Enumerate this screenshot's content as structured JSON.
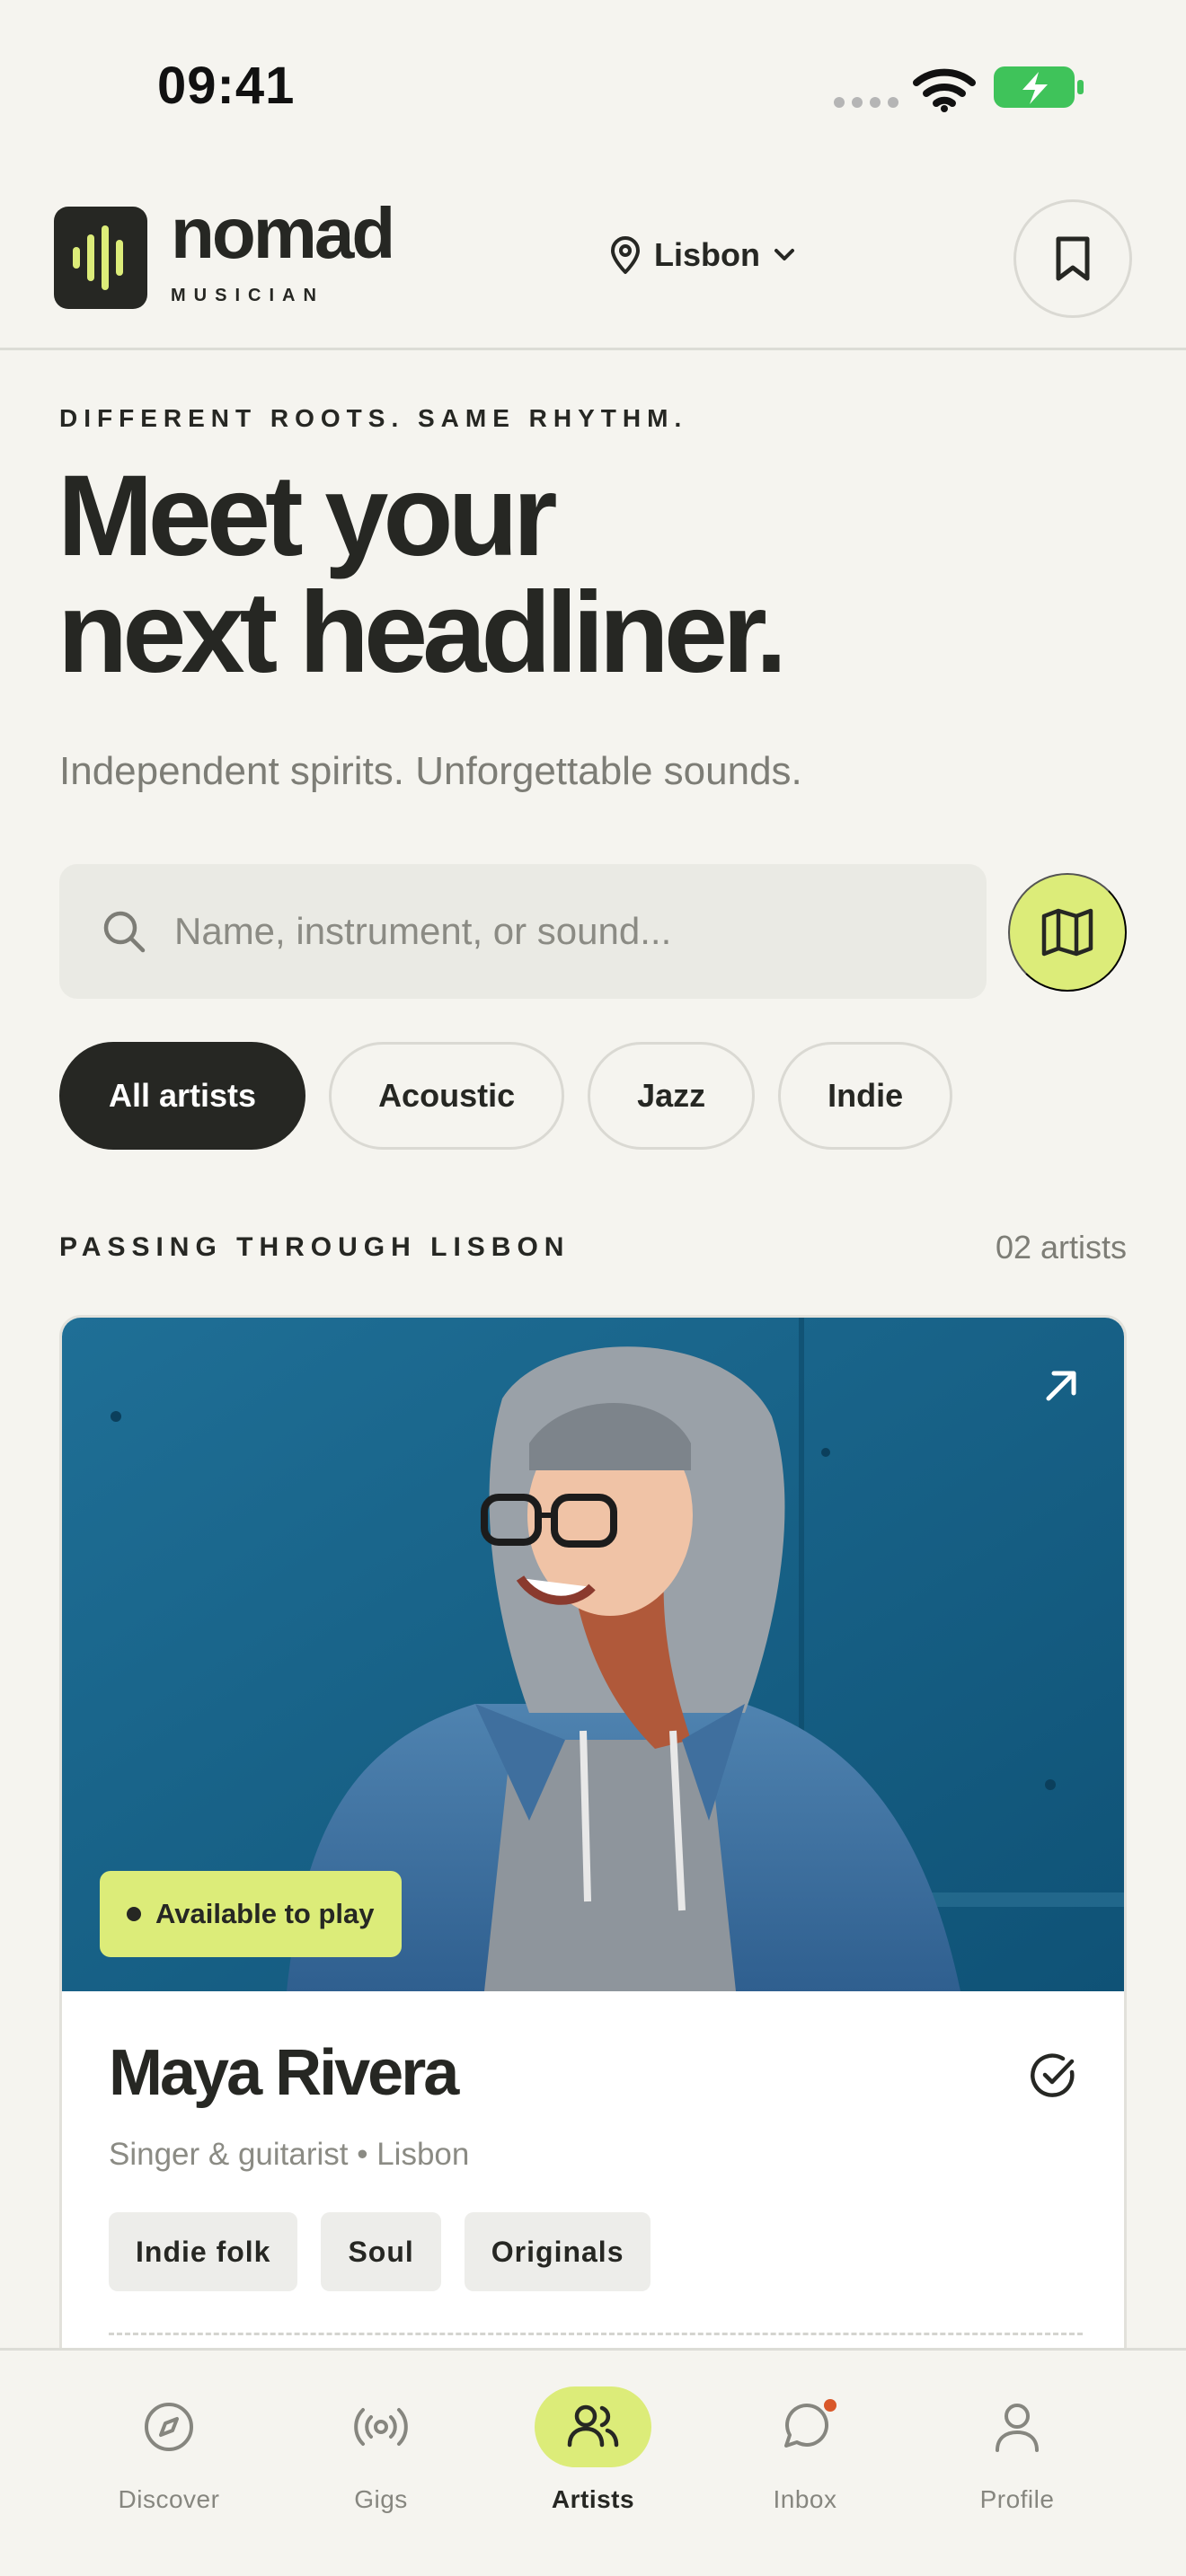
{
  "status_bar": {
    "time": "09:41"
  },
  "header": {
    "logo_word": "nomad",
    "logo_sub": "MUSICIAN",
    "location": "Lisbon"
  },
  "hero": {
    "eyebrow": "DIFFERENT ROOTS. SAME RHYTHM.",
    "title_line1": "Meet your",
    "title_line2": "next headliner.",
    "subtitle": "Independent spirits. Unforgettable sounds."
  },
  "search": {
    "placeholder": "Name, instrument, or sound..."
  },
  "filters": [
    {
      "label": "All artists",
      "active": true
    },
    {
      "label": "Acoustic",
      "active": false
    },
    {
      "label": "Jazz",
      "active": false
    },
    {
      "label": "Indie",
      "active": false
    }
  ],
  "section": {
    "title": "PASSING THROUGH LISBON",
    "count": "02 artists"
  },
  "artist": {
    "availability": "Available to play",
    "name": "Maya Rivera",
    "meta": "Singer & guitarist • Lisbon",
    "tags": [
      "Indie folk",
      "Soul",
      "Originals"
    ]
  },
  "bottom_nav": [
    {
      "label": "Discover",
      "icon": "compass-icon"
    },
    {
      "label": "Gigs",
      "icon": "broadcast-icon"
    },
    {
      "label": "Artists",
      "icon": "users-icon",
      "active": true
    },
    {
      "label": "Inbox",
      "icon": "chat-bubble-icon",
      "badge": true
    },
    {
      "label": "Profile",
      "icon": "user-icon"
    }
  ],
  "colors": {
    "background": "#f5f4ef",
    "ink": "#262723",
    "accent_lime": "#dcec79",
    "muted": "#7d7d76",
    "notification": "#d9582a"
  }
}
